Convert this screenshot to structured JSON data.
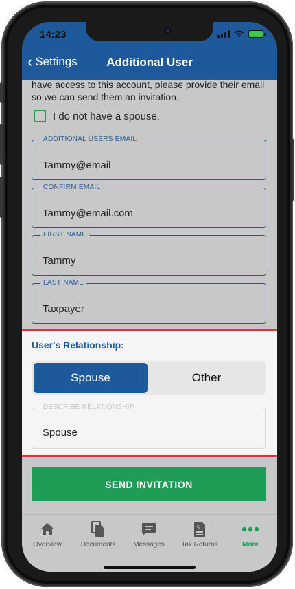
{
  "status_bar": {
    "time": "14:23"
  },
  "nav": {
    "back_label": "Settings",
    "title": "Additional User"
  },
  "intro_text": "have access to this account, please provide their email so we can send them an invitation.",
  "no_spouse": {
    "label": "I do not have a spouse.",
    "checked": false
  },
  "fields": [
    {
      "label": "ADDITIONAL USERS EMAIL",
      "value": "Tammy@email"
    },
    {
      "label": "CONFIRM EMAIL",
      "value": "Tammy@email.com"
    },
    {
      "label": "FIRST NAME",
      "value": "Tammy"
    },
    {
      "label": "LAST NAME",
      "value": "Taxpayer"
    }
  ],
  "relationship": {
    "title": "User's Relationship:",
    "options": [
      "Spouse",
      "Other"
    ],
    "selected": "Spouse",
    "describe_label": "DESCRIBE RELATIONSHIP",
    "describe_value": "Spouse"
  },
  "send_button": "SEND INVITATION",
  "tabs": [
    {
      "label": "Overview",
      "icon": "home-icon"
    },
    {
      "label": "Documents",
      "icon": "documents-icon"
    },
    {
      "label": "Messages",
      "icon": "messages-icon"
    },
    {
      "label": "Tax Returns",
      "icon": "tax-returns-icon"
    },
    {
      "label": "More",
      "icon": "more-icon",
      "active": true
    }
  ],
  "colors": {
    "brand_blue": "#1e5a9b",
    "action_green": "#1f9d57",
    "highlight_red": "#e0323a"
  }
}
